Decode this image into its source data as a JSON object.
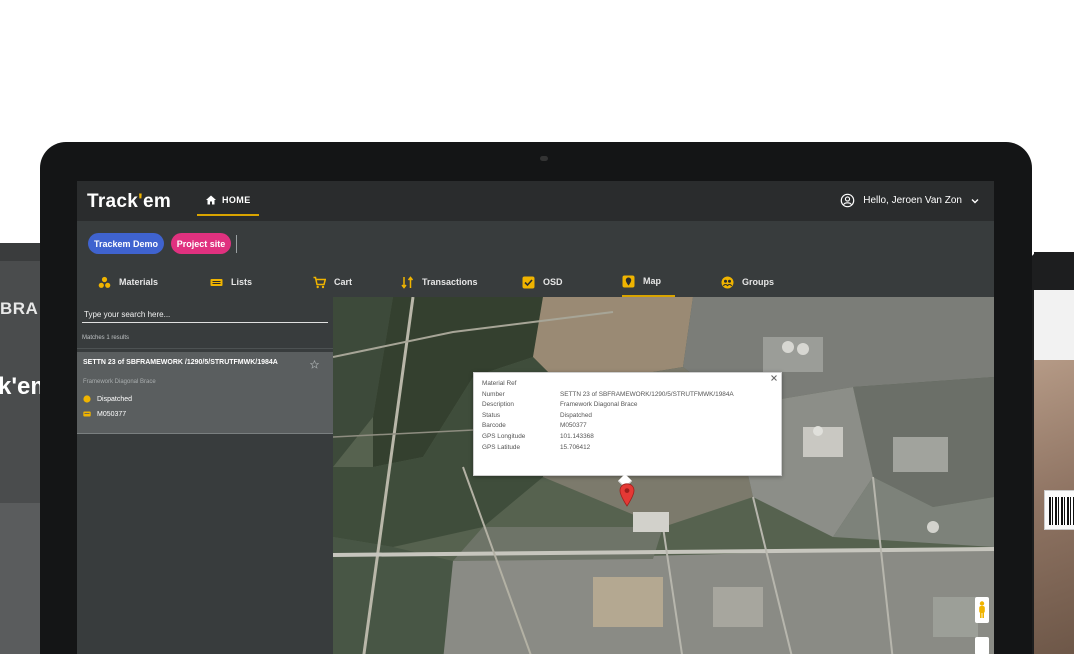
{
  "app": {
    "logo_main": "Track",
    "logo_accent": "'",
    "logo_tail": "em",
    "home_label": "HOME",
    "user_greeting": "Hello, Jeroen Van Zon"
  },
  "projects": {
    "chips": [
      "Trackem Demo",
      "Project site"
    ]
  },
  "nav": {
    "items": [
      "Materials",
      "Lists",
      "Cart",
      "Transactions",
      "OSD",
      "Map",
      "Groups"
    ],
    "active": "Map"
  },
  "sidebar": {
    "search_placeholder": "Type your search here...",
    "results_text": "Matches 1 results",
    "card": {
      "title": "SETTN 23 of SBFRAMEWORK /1290/5/STRUTFMWK/1984A",
      "subtitle": "Framework Diagonal Brace",
      "status": "Dispatched",
      "barcode": "M050377"
    }
  },
  "popup": {
    "rows": [
      {
        "key": "Material Ref",
        "value": ""
      },
      {
        "key": "Number",
        "value": "SETTN 23 of SBFRAMEWORK/1290/5/STRUTFMWK/1984A"
      },
      {
        "key": "Description",
        "value": "Framework Diagonal Brace"
      },
      {
        "key": "Status",
        "value": "Dispatched"
      },
      {
        "key": "Barcode",
        "value": "M050377"
      },
      {
        "key": "GPS Longitude",
        "value": "101.143368"
      },
      {
        "key": "GPS Latitude",
        "value": "15.706412"
      }
    ]
  },
  "background_devices": {
    "left_text_1": "BRA",
    "left_text_2": "k'em"
  },
  "colors": {
    "accent": "#d9a400",
    "chip_demo": "#3f63cf",
    "chip_site": "#e0317f",
    "topbar": "#2a2c2d",
    "panel": "#383c3d",
    "pin": "#e53935"
  },
  "icons": {
    "home": "home-icon",
    "user": "user-circle-icon",
    "materials": "materials-icon",
    "lists": "list-icon",
    "cart": "cart-icon",
    "transactions": "transactions-icon",
    "osd": "osd-icon",
    "map": "map-icon",
    "groups": "groups-icon",
    "pin": "map-pin-icon"
  }
}
